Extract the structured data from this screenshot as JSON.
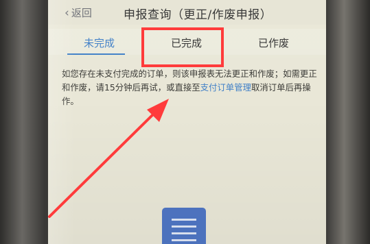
{
  "header": {
    "back_label": "返回",
    "title": "申报查询（更正/作废申报）"
  },
  "tabs": [
    {
      "label": "未完成",
      "active": true
    },
    {
      "label": "已完成",
      "active": false
    },
    {
      "label": "已作废",
      "active": false
    }
  ],
  "notice": {
    "text_before_link1": "如您存在未支付完成的订单，则该申报表无法更正和作废；如需更正和作废，请15分钟后再试，或直接至",
    "link": "支付订单管理",
    "text_after_link": "取消订单后再操作。"
  },
  "colors": {
    "accent": "#3f7fc7",
    "annotation": "#ff3b3b",
    "icon_blue": "#4f76c4"
  },
  "icons": {
    "back": "chevron-left-icon",
    "document": "document-icon"
  }
}
